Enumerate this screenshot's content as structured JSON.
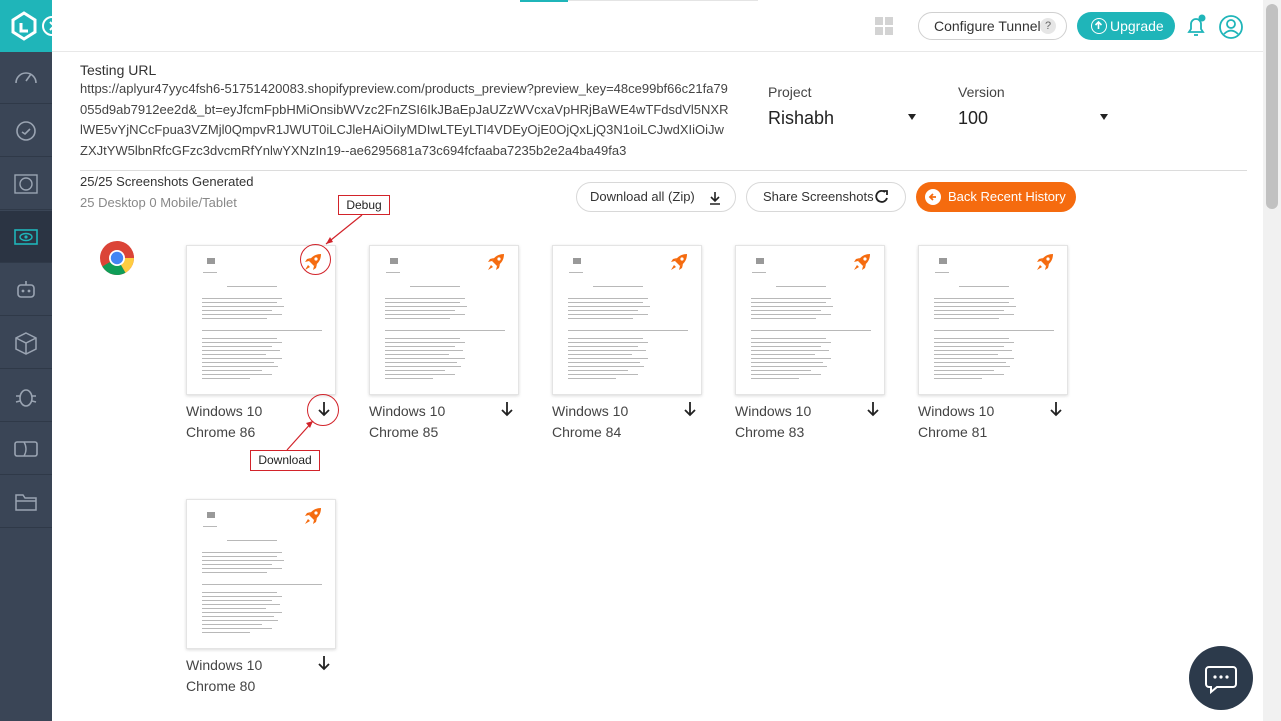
{
  "topbar": {
    "configure_tunnel": "Configure Tunnel",
    "help_glyph": "?",
    "upgrade": "Upgrade"
  },
  "testing": {
    "label": "Testing URL",
    "url": "https://aplyur47yyc4fsh6-51751420083.shopifypreview.com/products_preview?preview_key=48ce99bf66c21fa79055d9ab7912ee2d&_bt=eyJfcmFpbHMiOnsibWVzc2FnZSI6IkJBaEpJaUZzWVcxaVpHRjBaWE4wTFdsdVl5NXRlWE5vYjNCcFpua3VZMjl0QmpvR1JWUT0iLCJleHAiOiIyMDIwLTEyLTI4VDEyOjE0OjQxLjQ3N1oiLCJwdXIiOiJwZXJtYW5lbnRfcGFzc3dvcmRfYnlwYXNzIn19--ae6295681a73c694fcfaaba7235b2e2a4ba49fa3"
  },
  "project": {
    "label": "Project",
    "value": "Rishabh"
  },
  "version": {
    "label": "Version",
    "value": "100"
  },
  "summary": {
    "count": "25/25 Screenshots Generated",
    "breakdown": "25 Desktop 0 Mobile/Tablet"
  },
  "actions": {
    "download_all": "Download all (Zip)",
    "share": "Share Screenshots",
    "back": "Back Recent History"
  },
  "annotations": {
    "debug": "Debug",
    "download": "Download"
  },
  "screenshots": [
    {
      "os": "Windows 10",
      "browser": "Chrome 86"
    },
    {
      "os": "Windows 10",
      "browser": "Chrome 85"
    },
    {
      "os": "Windows 10",
      "browser": "Chrome 84"
    },
    {
      "os": "Windows 10",
      "browser": "Chrome 83"
    },
    {
      "os": "Windows 10",
      "browser": "Chrome 81"
    },
    {
      "os": "Windows 10",
      "browser": "Chrome 80"
    }
  ],
  "colors": {
    "teal": "#1fb5b9",
    "orange": "#f56b0f",
    "sidebar": "#3a4556",
    "annotation": "#d2232a"
  },
  "icons": [
    "lambdatest-logo-icon",
    "expand-icon",
    "speedometer-icon",
    "clock-icon",
    "globe-icon",
    "eye-screen-icon",
    "robot-icon",
    "box-icon",
    "bug-icon",
    "ticket-icon",
    "folder-icon",
    "grid-icon",
    "bell-icon",
    "user-icon",
    "download-icon",
    "share-icon",
    "back-icon",
    "chrome-logo-icon",
    "rocket-icon",
    "chat-icon"
  ]
}
